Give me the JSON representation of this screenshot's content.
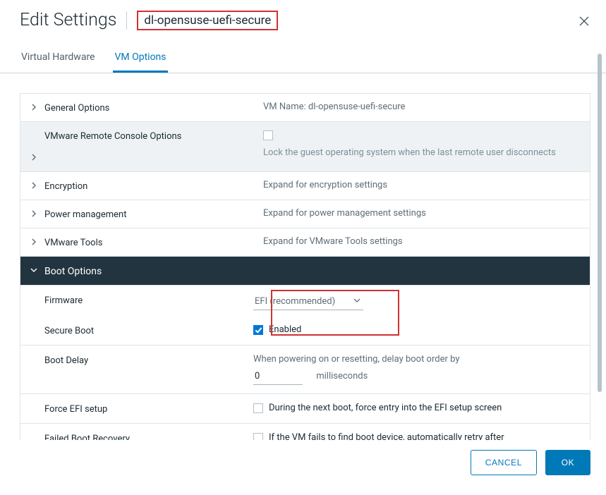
{
  "header": {
    "title": "Edit Settings",
    "vm_name": "dl-opensuse-uefi-secure"
  },
  "tabs": {
    "hardware": "Virtual Hardware",
    "options": "VM Options"
  },
  "rows": {
    "general": {
      "label": "General Options",
      "value": "VM Name: dl-opensuse-uefi-secure"
    },
    "vmrc": {
      "label": "VMware Remote Console Options",
      "value": "Lock the guest operating system when the last remote user disconnects"
    },
    "encryption": {
      "label": "Encryption",
      "value": "Expand for encryption settings"
    },
    "power": {
      "label": "Power management",
      "value": "Expand for power management settings"
    },
    "tools": {
      "label": "VMware Tools",
      "value": "Expand for VMware Tools settings"
    },
    "boot": {
      "label": "Boot Options"
    }
  },
  "boot": {
    "firmware_label": "Firmware",
    "firmware_value": "EFI (recommended)",
    "secure_label": "Secure Boot",
    "secure_value": "Enabled",
    "delay_label": "Boot Delay",
    "delay_desc": "When powering on or resetting, delay boot order by",
    "delay_value": "0",
    "delay_unit": "milliseconds",
    "force_label": "Force EFI setup",
    "force_desc": "During the next boot, force entry into the EFI setup screen",
    "failed_label": "Failed Boot Recovery",
    "failed_desc": "If the VM fails to find boot device, automatically retry after"
  },
  "footer": {
    "cancel": "CANCEL",
    "ok": "OK"
  }
}
